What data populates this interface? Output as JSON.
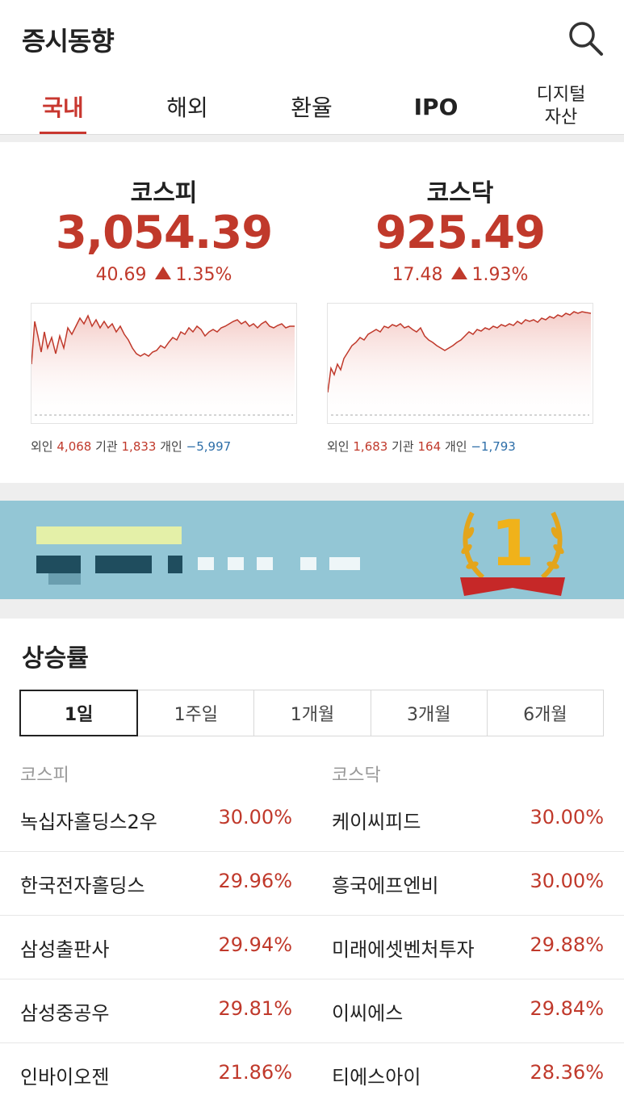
{
  "header": {
    "title": "증시동향",
    "search_icon": "search-icon"
  },
  "tabs": [
    {
      "label": "국내",
      "active": true
    },
    {
      "label": "해외",
      "active": false
    },
    {
      "label": "환율",
      "active": false
    },
    {
      "label": "IPO",
      "active": false
    },
    {
      "label": "디지털\n자산",
      "line1": "디지털",
      "line2": "자산",
      "active": false
    }
  ],
  "markets": [
    {
      "name": "코스피",
      "value": "3,054.39",
      "change": "40.69",
      "change_pct": "1.35%",
      "direction": "up",
      "investors": {
        "foreign_label": "외인",
        "foreign": "4,068",
        "inst_label": "기관",
        "inst": "1,833",
        "indiv_label": "개인",
        "indiv": "−5,997"
      }
    },
    {
      "name": "코스닥",
      "value": "925.49",
      "change": "17.48",
      "change_pct": "1.93%",
      "direction": "up",
      "investors": {
        "foreign_label": "외인",
        "foreign": "1,683",
        "inst_label": "기관",
        "inst": "164",
        "indiv_label": "개인",
        "indiv": "−1,793"
      }
    }
  ],
  "banner": {
    "badge_text": "1"
  },
  "gainers": {
    "title": "상승률",
    "periods": [
      {
        "label": "1일",
        "active": true
      },
      {
        "label": "1주일",
        "active": false
      },
      {
        "label": "1개월",
        "active": false
      },
      {
        "label": "3개월",
        "active": false
      },
      {
        "label": "6개월",
        "active": false
      }
    ],
    "kospi_label": "코스피",
    "kosdaq_label": "코스닥",
    "rows": [
      {
        "kospi_name": "녹십자홀딩스2우",
        "kospi_rate": "30.00%",
        "kosdaq_name": "케이씨피드",
        "kosdaq_rate": "30.00%"
      },
      {
        "kospi_name": "한국전자홀딩스",
        "kospi_rate": "29.96%",
        "kosdaq_name": "흥국에프엔비",
        "kosdaq_rate": "30.00%"
      },
      {
        "kospi_name": "삼성출판사",
        "kospi_rate": "29.94%",
        "kosdaq_name": "미래에셋벤처투자",
        "kosdaq_rate": "29.88%"
      },
      {
        "kospi_name": "삼성중공우",
        "kospi_rate": "29.81%",
        "kosdaq_name": "이씨에스",
        "kosdaq_rate": "29.84%"
      },
      {
        "kospi_name": "인바이오젠",
        "kospi_rate": "21.86%",
        "kosdaq_name": "티에스아이",
        "kosdaq_rate": "28.36%"
      }
    ]
  },
  "colors": {
    "accent": "#c8372f",
    "up": "#c0392b",
    "down": "#2d6ea8",
    "banner_bg": "#93c6d5"
  }
}
